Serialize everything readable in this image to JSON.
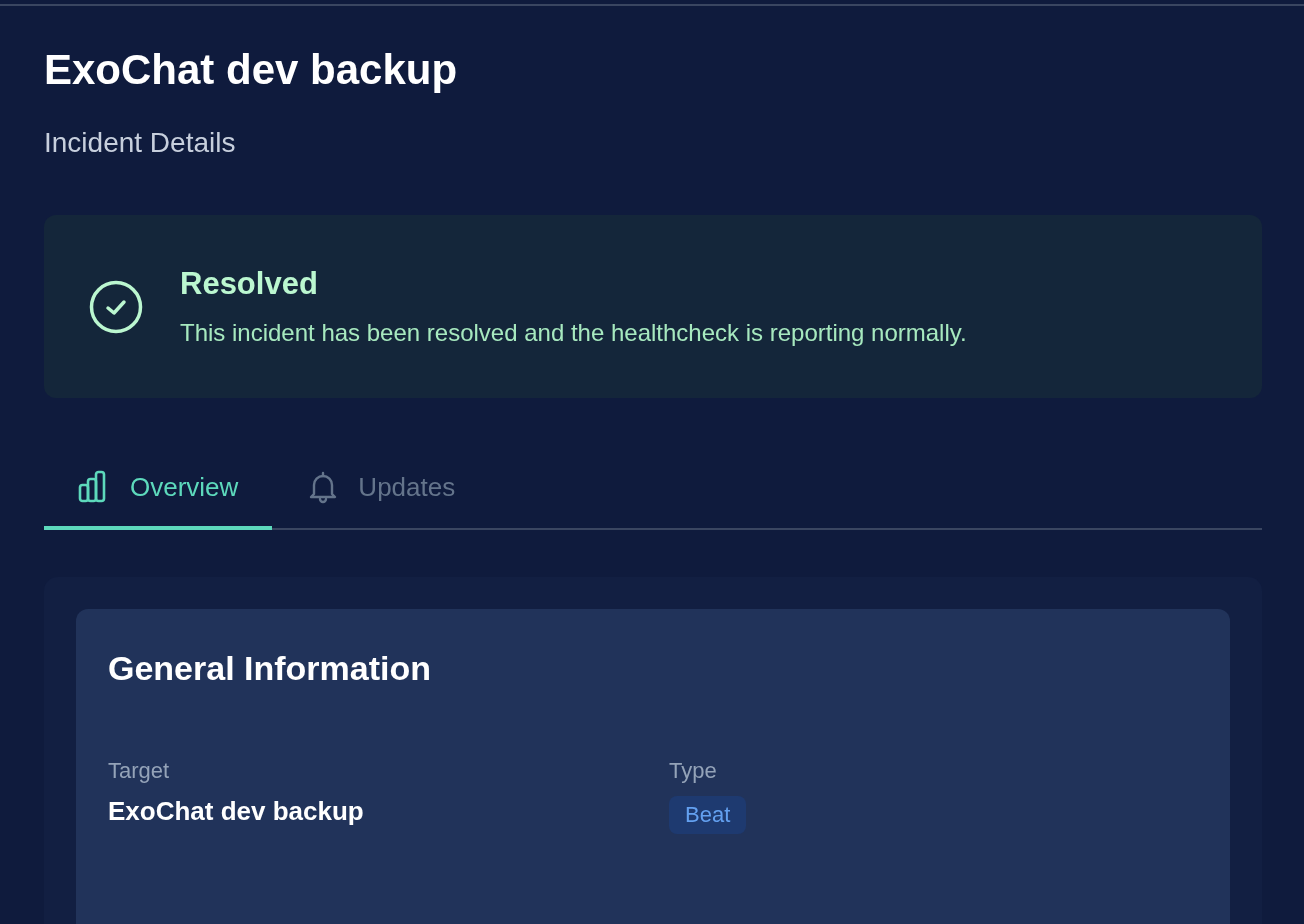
{
  "page": {
    "title": "ExoChat dev backup",
    "subtitle": "Incident Details"
  },
  "alert": {
    "kind": "resolved",
    "title": "Resolved",
    "message": "This incident has been resolved and the healthcheck is reporting normally."
  },
  "tabs": [
    {
      "label": "Overview",
      "kind": "chart",
      "selected": true
    },
    {
      "label": "Updates",
      "kind": "bell",
      "selected": false
    }
  ],
  "general_information": {
    "title": "General Information",
    "fields": [
      {
        "label": "Target",
        "value": "ExoChat dev backup",
        "kind": "text"
      },
      {
        "label": "Type",
        "value": "Beat",
        "kind": "badge"
      }
    ]
  }
}
